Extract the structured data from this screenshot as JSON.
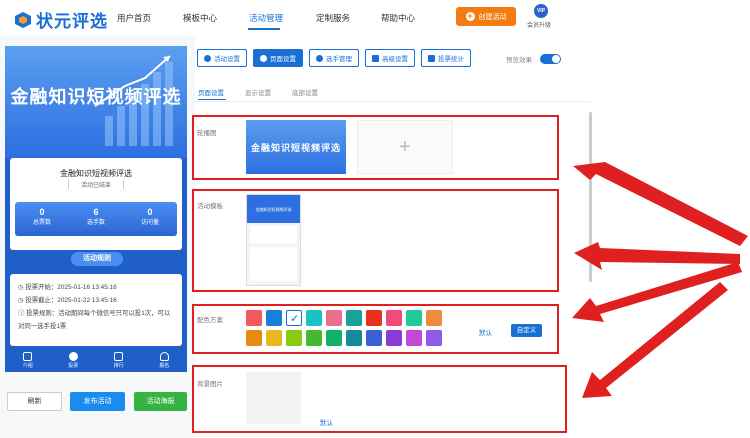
{
  "brand": {
    "name": "状元评选"
  },
  "nav": {
    "items": [
      "用户首页",
      "模板中心",
      "活动管理",
      "定制服务",
      "帮助中心"
    ],
    "active_index": 2
  },
  "header": {
    "create_label": "创建活动",
    "vip_badge": "VIP",
    "vip_label": "会员升级"
  },
  "colors": {
    "accent": "#1a6fd6",
    "orange": "#f47b12",
    "green": "#35b343",
    "annotation": "#e02020"
  },
  "phone": {
    "banner_title": "金融知识短视频评选",
    "card_title": "金融知识短视频评选",
    "status": "活动已结束",
    "stats": [
      {
        "value": "0",
        "label": "总票数"
      },
      {
        "value": "6",
        "label": "选手数"
      },
      {
        "value": "0",
        "label": "访问量"
      }
    ],
    "rules_label": "活动规则",
    "info": [
      "投票开始：2025-01-16 13:45:16",
      "投票截止：2025-01-22 13:45:16",
      "投票规则：活动期间每个微信号只可以投1次，可以对同一选手投1票"
    ],
    "tabs": [
      "介绍",
      "投票",
      "排行",
      "报名"
    ]
  },
  "actions": {
    "refresh": "刷新",
    "publish": "发布活动",
    "poster": "活动海报"
  },
  "toolbar": {
    "buttons": [
      "活动设置",
      "页面设置",
      "选手管理",
      "高级设置",
      "投票统计"
    ],
    "active_index": 1,
    "preview_label": "预览效果",
    "preview_on": true
  },
  "subtabs": {
    "items": [
      "页面设置",
      "显示设置",
      "底部设置"
    ],
    "active_index": 0
  },
  "sections": {
    "carousel": {
      "label": "轮播图",
      "image_text": "金融知识短视频评选",
      "add_symbol": "+"
    },
    "template": {
      "label": "活动模板",
      "thumb_title": "金融知识短视频评选"
    },
    "color_scheme": {
      "label": "配色方案",
      "selected_index": 2,
      "swatches": [
        "#f05a5a",
        "#1a7fd6",
        "#ffffff",
        "#17c3c3",
        "#e8708a",
        "#17a39a",
        "#e83020",
        "#f04b7a",
        "#20c99a",
        "#f08a40",
        "#e88a10",
        "#e8b820",
        "#8acb10",
        "#45b830",
        "#13b06a",
        "#178a9a",
        "#3a5fd6",
        "#8a3ad6",
        "#c248d6",
        "#8f5ae6"
      ],
      "default_label": "默认",
      "custom_label": "自定义"
    },
    "background": {
      "label": "背景图片",
      "default_label": "默认"
    }
  }
}
